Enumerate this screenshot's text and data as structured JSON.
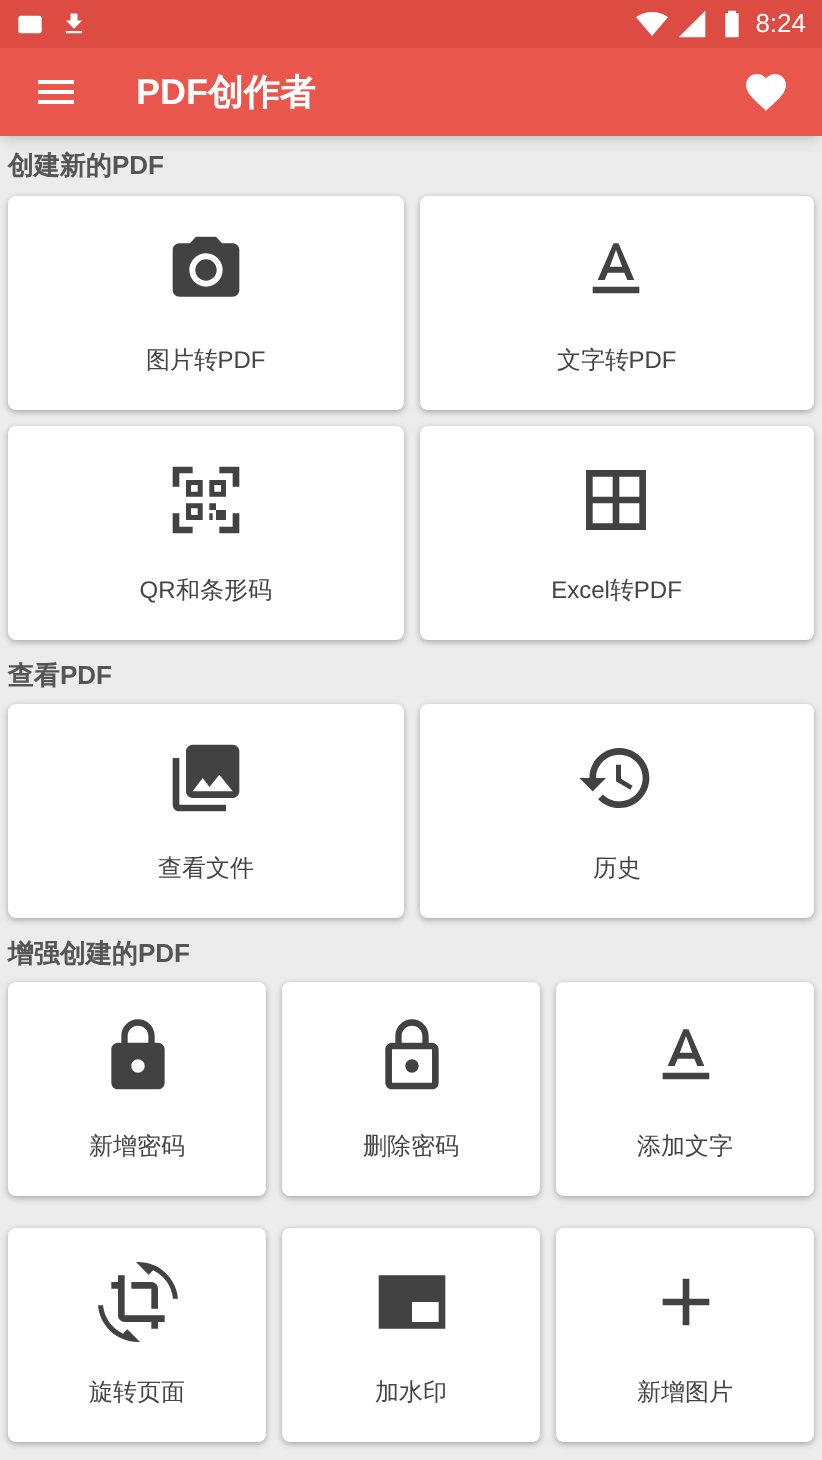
{
  "status_bar": {
    "time": "8:24"
  },
  "app_bar": {
    "title": "PDF创作者"
  },
  "sections": [
    {
      "title": "创建新的PDF",
      "items": [
        {
          "label": "图片转PDF",
          "kind": "camera"
        },
        {
          "label": "文字转PDF",
          "kind": "text"
        },
        {
          "label": "QR和条形码",
          "kind": "qr"
        },
        {
          "label": "Excel转PDF",
          "kind": "grid"
        }
      ]
    },
    {
      "title": "查看PDF",
      "items": [
        {
          "label": "查看文件",
          "kind": "photos"
        },
        {
          "label": "历史",
          "kind": "history"
        }
      ]
    },
    {
      "title": "增强创建的PDF",
      "items": [
        {
          "label": "新增密码",
          "kind": "lock"
        },
        {
          "label": "删除密码",
          "kind": "unlock"
        },
        {
          "label": "添加文字",
          "kind": "text"
        },
        {
          "label": "旋转页面",
          "kind": "rotate"
        },
        {
          "label": "加水印",
          "kind": "watermark"
        },
        {
          "label": "新增图片",
          "kind": "add"
        }
      ]
    }
  ]
}
